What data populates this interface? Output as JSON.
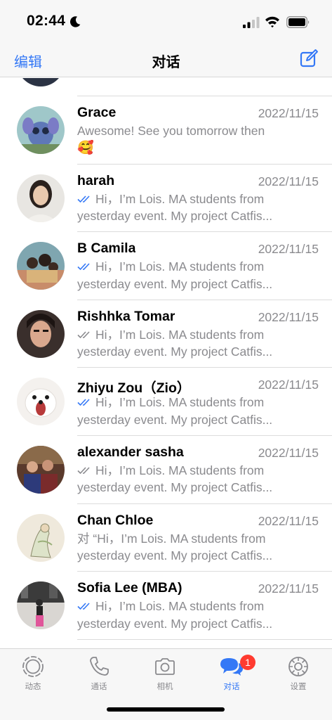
{
  "status_bar": {
    "time": "02:44"
  },
  "nav": {
    "left_label": "编辑",
    "title": "对话"
  },
  "chats": [
    {
      "name": "Grace",
      "date": "2022/11/15",
      "line1": "Awesome! See you tomorrow then",
      "line2": "🥰",
      "ticks": "none"
    },
    {
      "name": "harah",
      "date": "2022/11/15",
      "line1": "Hi，I’m Lois. MA students from",
      "line2": "yesterday event. My project Catfis...",
      "ticks": "blue"
    },
    {
      "name": "B Camila",
      "date": "2022/11/15",
      "line1": "Hi，I’m Lois. MA students from",
      "line2": "yesterday event. My project Catfis...",
      "ticks": "blue"
    },
    {
      "name": "Rishhka Tomar",
      "date": "2022/11/15",
      "line1": "Hi，I’m Lois. MA students from",
      "line2": "yesterday event. My project Catfis...",
      "ticks": "gray"
    },
    {
      "name": "Zhiyu Zou（Zio）",
      "date": "2022/11/15",
      "line1": "Hi，I’m Lois. MA students from",
      "line2": "yesterday event. My project Catfis...",
      "ticks": "blue"
    },
    {
      "name": "alexander sasha",
      "date": "2022/11/15",
      "line1": "Hi，I’m Lois. MA students from",
      "line2": "yesterday event. My project Catfis...",
      "ticks": "gray"
    },
    {
      "name": "Chan Chloe",
      "date": "2022/11/15",
      "line1": "对 “Hi，I’m Lois. MA students from",
      "line2": "yesterday event. My project Catfis...",
      "ticks": "none"
    },
    {
      "name": "Sofia Lee (MBA)",
      "date": "2022/11/15",
      "line1": "Hi，I’m Lois. MA students from",
      "line2": "yesterday event. My project Catfis...",
      "ticks": "blue"
    }
  ],
  "tabs": [
    {
      "label": "动态",
      "icon": "status-icon"
    },
    {
      "label": "通话",
      "icon": "phone-icon"
    },
    {
      "label": "相机",
      "icon": "camera-icon"
    },
    {
      "label": "对话",
      "icon": "chats-icon",
      "badge": "1",
      "active": true
    },
    {
      "label": "设置",
      "icon": "settings-icon"
    }
  ],
  "colors": {
    "accent": "#3478f6",
    "badge": "#ff3b30",
    "read_ticks": "#3478f6",
    "delivered_ticks": "#8a8a8e"
  }
}
